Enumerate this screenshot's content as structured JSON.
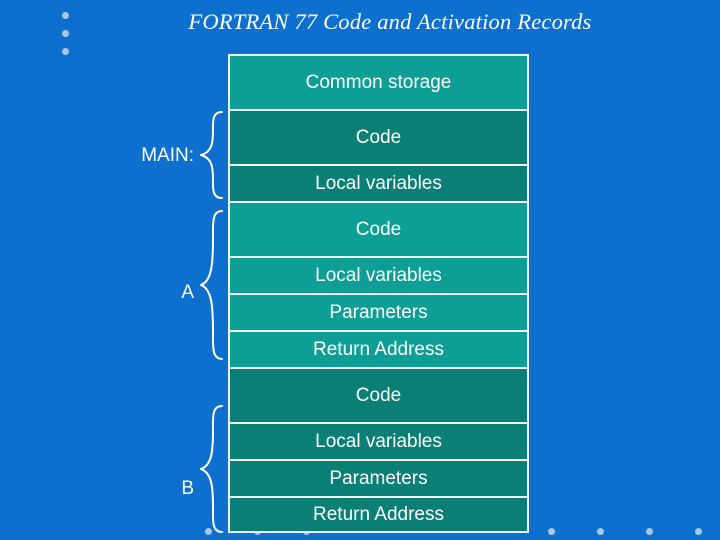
{
  "slide": {
    "title": "FORTRAN 77 Code and Activation Records",
    "background_color": "#0d6fce",
    "box_border_color": "#f2fbfb",
    "text_color": "#ffffff",
    "bullet_dot_color": "#a8c8e8"
  },
  "diagram": {
    "segments": [
      {
        "label": "Common storage",
        "color": "#0d9e96",
        "height": "tall"
      },
      {
        "label": "Code",
        "color": "#0a7f75",
        "height": "tall"
      },
      {
        "label": "Local variables",
        "color": "#0a7f75",
        "height": "short"
      },
      {
        "label": "Code",
        "color": "#0d9e96",
        "height": "tall"
      },
      {
        "label": "Local variables",
        "color": "#0d9e96",
        "height": "short"
      },
      {
        "label": "Parameters",
        "color": "#0d9e96",
        "height": "short"
      },
      {
        "label": "Return Address",
        "color": "#0d9e96",
        "height": "short"
      },
      {
        "label": "Code",
        "color": "#0a7f75",
        "height": "tall"
      },
      {
        "label": "Local variables",
        "color": "#0a7f75",
        "height": "short"
      },
      {
        "label": "Parameters",
        "color": "#0a7f75",
        "height": "short"
      },
      {
        "label": "Return Address",
        "color": "#0a7f75",
        "height": "short"
      }
    ],
    "groups": [
      {
        "name": "main",
        "label": "MAIN:"
      },
      {
        "name": "a",
        "label": "A"
      },
      {
        "name": "b",
        "label": "B"
      }
    ]
  }
}
